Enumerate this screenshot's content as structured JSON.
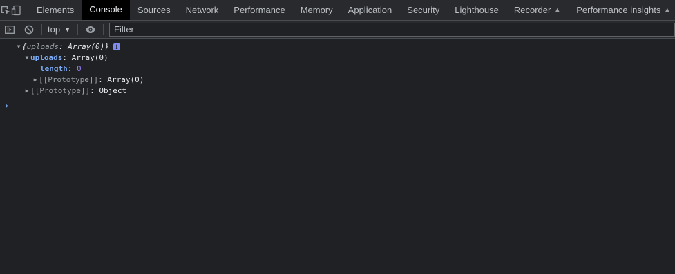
{
  "tabs": [
    {
      "label": "Elements",
      "active": false
    },
    {
      "label": "Console",
      "active": true
    },
    {
      "label": "Sources",
      "active": false
    },
    {
      "label": "Network",
      "active": false
    },
    {
      "label": "Performance",
      "active": false
    },
    {
      "label": "Memory",
      "active": false
    },
    {
      "label": "Application",
      "active": false
    },
    {
      "label": "Security",
      "active": false
    },
    {
      "label": "Lighthouse",
      "active": false
    },
    {
      "label": "Recorder",
      "active": false,
      "icon": "flask-icon"
    },
    {
      "label": "Performance insights",
      "active": false,
      "icon": "flask-icon"
    }
  ],
  "tabbar_icons": [
    "inspect-element-icon",
    "device-toolbar-icon"
  ],
  "toolbar": {
    "icons": [
      "sidebar-toggle-icon",
      "clear-console-icon",
      "live-expression-eye-icon"
    ],
    "context": "top",
    "filter_placeholder": "Filter",
    "filter_value": ""
  },
  "console": {
    "summary": {
      "open": "{",
      "key": "uploads",
      "sep": ": ",
      "value": "Array(0)",
      "close": "}",
      "badge": "i"
    },
    "uploads_row": {
      "key": "uploads",
      "sep": ": ",
      "value": "Array(0)"
    },
    "length_row": {
      "key": "length",
      "sep": ": ",
      "value": "0"
    },
    "array_proto_row": {
      "key": "[[Prototype]]",
      "sep": ": ",
      "value": "Array(0)"
    },
    "obj_proto_row": {
      "key": "[[Prototype]]",
      "sep": ": ",
      "value": "Object"
    },
    "prompt_symbol": "›"
  },
  "colors": {
    "background": "#202124",
    "toolbar": "#292a2d",
    "active_tab": "#000000",
    "own_key": "#7cacf8",
    "number": "#9980ff",
    "info_badge": "#7e8cf3"
  }
}
